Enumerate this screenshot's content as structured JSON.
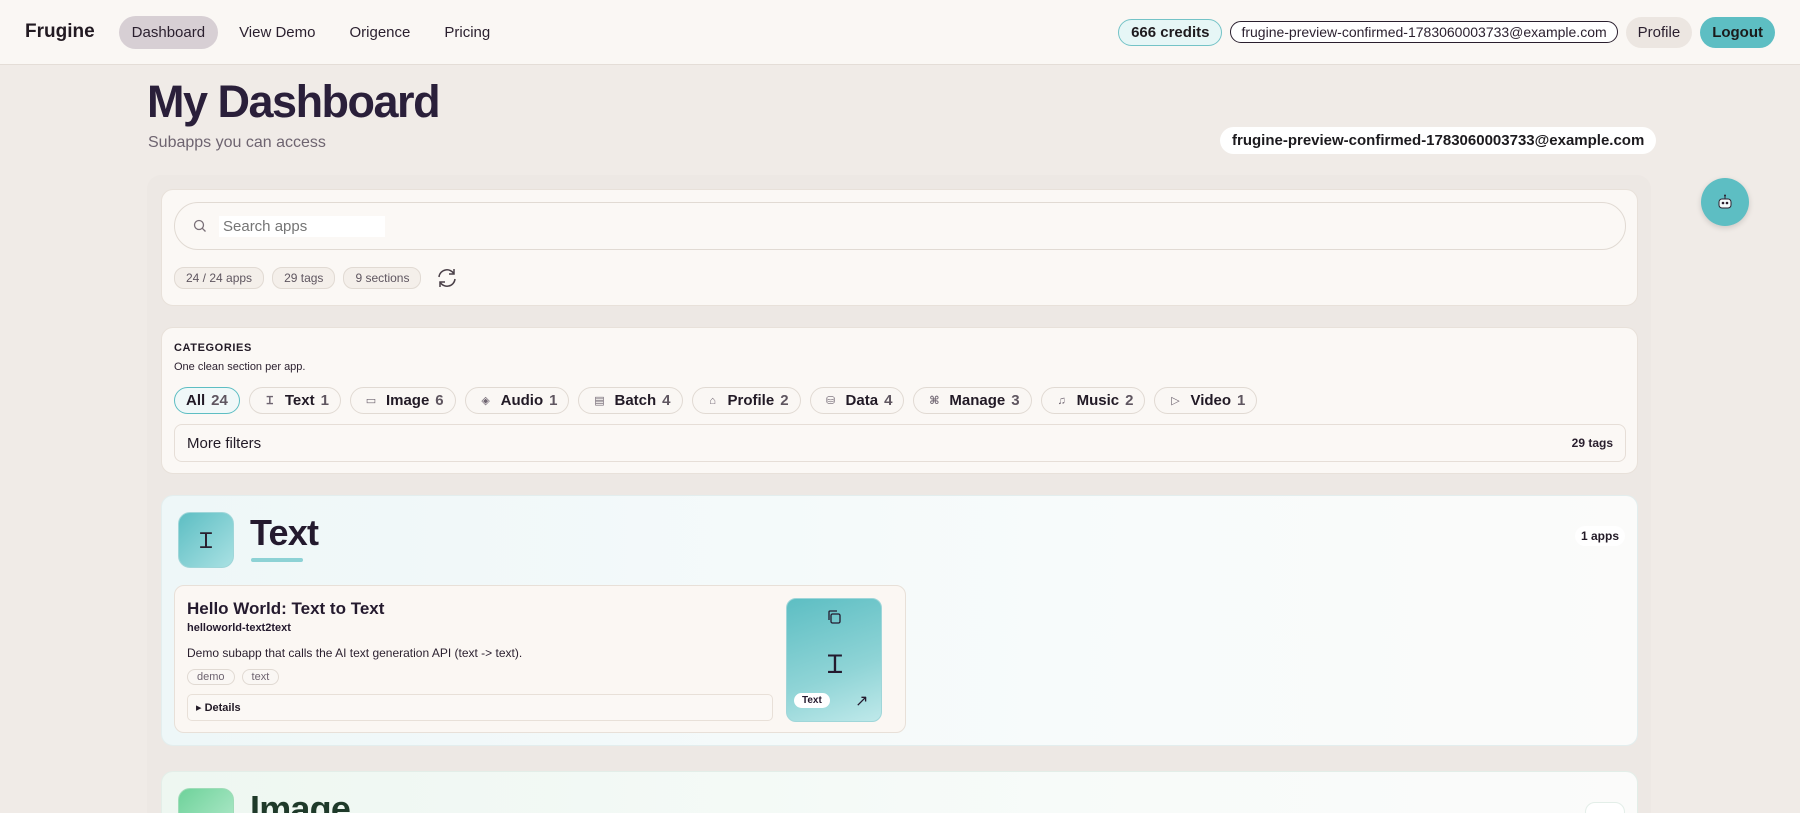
{
  "nav": {
    "brand": "Frugine",
    "links": [
      "Dashboard",
      "View Demo",
      "Origence",
      "Pricing"
    ],
    "credits": "666 credits",
    "email": "frugine-preview-confirmed-1783060003733@example.com",
    "profile": "Profile",
    "logout": "Logout"
  },
  "header": {
    "title": "My Dashboard",
    "subtitle": "Subapps you can access",
    "user_email": "frugine-preview-confirmed-1783060003733@example.com"
  },
  "search": {
    "placeholder": "Search apps",
    "stats": [
      "24 / 24 apps",
      "29 tags",
      "9 sections"
    ]
  },
  "categories": {
    "heading": "CATEGORIES",
    "subtitle": "One clean section per app.",
    "items": [
      {
        "label": "All",
        "count": "24",
        "icon": ""
      },
      {
        "label": "Text",
        "count": "1",
        "icon": "Ɪ"
      },
      {
        "label": "Image",
        "count": "6",
        "icon": "▭"
      },
      {
        "label": "Audio",
        "count": "1",
        "icon": "◈"
      },
      {
        "label": "Batch",
        "count": "4",
        "icon": "▤"
      },
      {
        "label": "Profile",
        "count": "2",
        "icon": "⌂"
      },
      {
        "label": "Data",
        "count": "4",
        "icon": "⛁"
      },
      {
        "label": "Manage",
        "count": "3",
        "icon": "⌘"
      },
      {
        "label": "Music",
        "count": "2",
        "icon": "♫"
      },
      {
        "label": "Video",
        "count": "1",
        "icon": "▷"
      }
    ],
    "more_filters": "More filters",
    "tag_count": "29 tags"
  },
  "sections": [
    {
      "title": "Text",
      "count": "1 apps",
      "icon": "Ɪ",
      "apps": [
        {
          "title": "Hello World: Text to Text",
          "slug": "helloworld-text2text",
          "description": "Demo subapp that calls the AI text generation API (text -> text).",
          "tags": [
            "demo",
            "text"
          ],
          "details": "▸ Details",
          "thumb_icon": "Ɪ",
          "thumb_tag": "Text",
          "thumb_arrow": "↗"
        }
      ]
    },
    {
      "title": "Image"
    }
  ],
  "colors": {
    "accent": "#5dbec3",
    "background": "#f0ebe7",
    "title": "#2a1f3a"
  }
}
